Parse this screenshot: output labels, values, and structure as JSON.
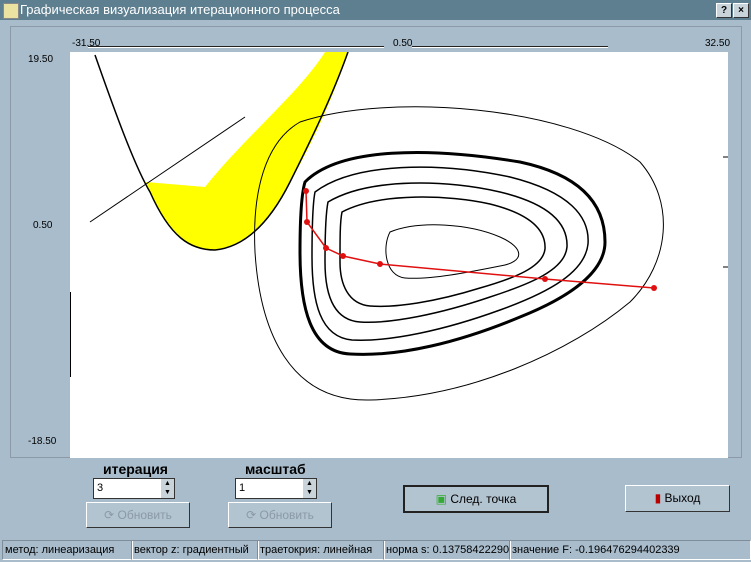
{
  "window": {
    "title": "Графическая визуализация итерационного процесса",
    "help": "?",
    "close": "×"
  },
  "axes": {
    "x_min": "-31.50",
    "x_mid": "0.50",
    "x_max": "32.50",
    "y_max": "19.50",
    "y_mid": "0.50",
    "y_min": "-18.50"
  },
  "controls": {
    "iteration_label": "итерация",
    "iteration_value": "3",
    "scale_label": "масштаб",
    "scale_value": "1",
    "refresh1": "Обновить",
    "refresh2": "Обновить",
    "next_point": "След. точка",
    "exit": "Выход"
  },
  "status": [
    "метод: линеаризация",
    "вектор z: градиентный",
    "траетокрия: линейная",
    "норма s: 0.13758422290",
    "значение F: -0.196476294402339"
  ],
  "colors": {
    "trajectory": "#e01010",
    "region": "#ffff00"
  }
}
